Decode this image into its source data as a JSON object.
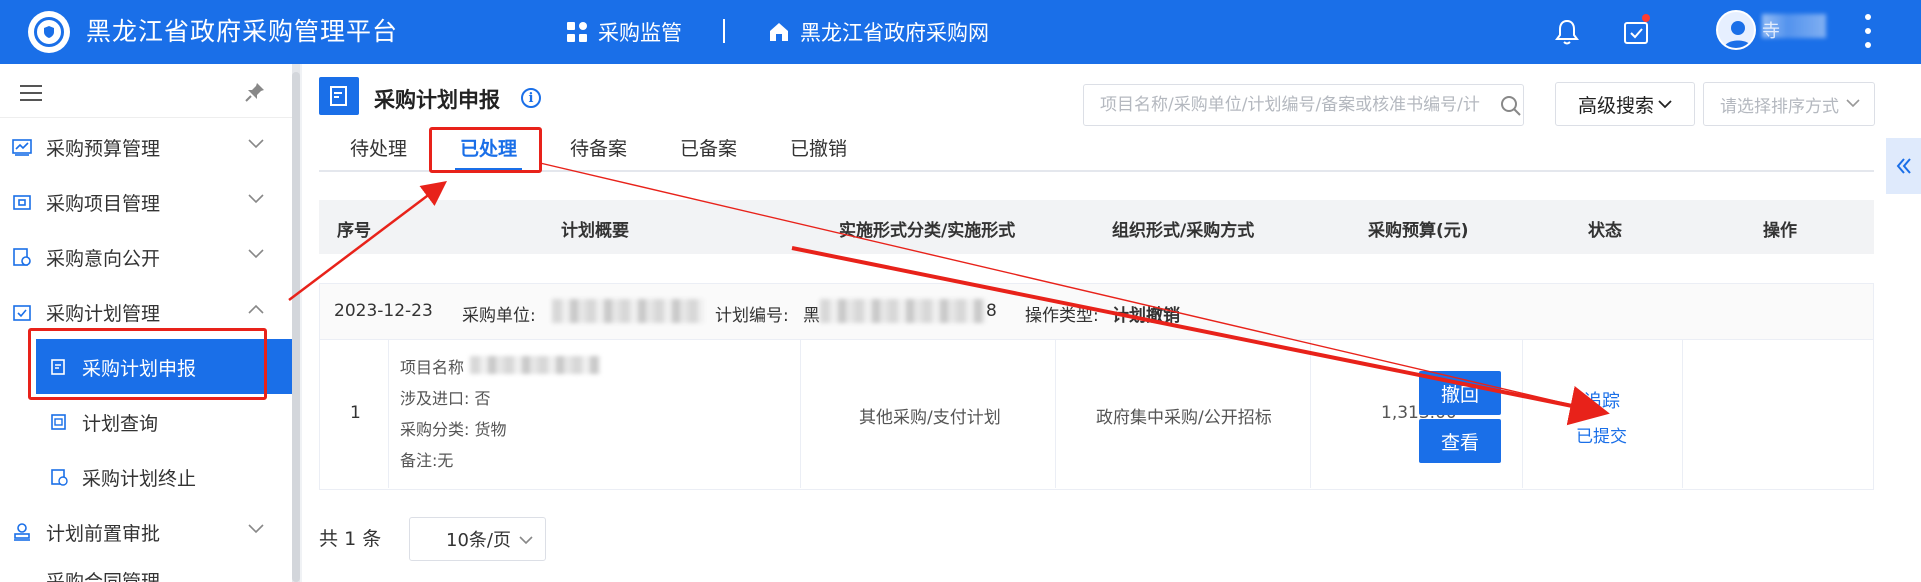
{
  "app": {
    "title": "黑龙江省政府采购管理平台"
  },
  "topnav": {
    "item1": "采购监管",
    "item2": "黑龙江省政府采购网"
  },
  "user": {
    "name_fragment": "寺"
  },
  "sidebar": {
    "items": [
      {
        "label": "采购预算管理"
      },
      {
        "label": "采购项目管理"
      },
      {
        "label": "采购意向公开"
      },
      {
        "label": "采购计划管理"
      },
      {
        "label": "计划前置审批"
      },
      {
        "label": "采购合同管理"
      }
    ],
    "sub_items": [
      {
        "label": "采购计划申报"
      },
      {
        "label": "计划查询"
      },
      {
        "label": "采购计划终止"
      }
    ]
  },
  "page": {
    "title": "采购计划申报"
  },
  "search": {
    "placeholder": "项目名称/采购单位/计划编号/备案或核准书编号/计"
  },
  "toolbar": {
    "advanced_label": "高级搜索",
    "sort_placeholder": "请选择排序方式"
  },
  "tabs": [
    {
      "label": "待处理"
    },
    {
      "label": "已处理"
    },
    {
      "label": "待备案"
    },
    {
      "label": "已备案"
    },
    {
      "label": "已撤销"
    }
  ],
  "table": {
    "headers": [
      "序号",
      "计划概要",
      "实施形式分类/实施形式",
      "组织形式/采购方式",
      "采购预算(元)",
      "状态",
      "操作"
    ]
  },
  "record": {
    "date": "2023-12-23",
    "unit_label": "采购单位:",
    "plan_no_label": "计划编号:",
    "plan_no_prefix": "黑",
    "plan_no_suffix": "8",
    "op_type_label": "操作类型:",
    "op_type_value": "计划撤销",
    "index": "1",
    "project_name_label": "项目名称",
    "import_label": "涉及进口:",
    "import_value": "否",
    "category_label": "采购分类:",
    "category_value": "货物",
    "remark_label": "备注:",
    "remark_value": "无",
    "impl_form": "其他采购/支付计划",
    "org_form": "政府集中采购/公开招标",
    "budget": "1,313.00",
    "track_link": "追踪",
    "status": "已提交",
    "withdraw_button": "撤回",
    "view_button": "查看"
  },
  "pagination": {
    "total_prefix": "共",
    "total_count": "1",
    "total_suffix": "条",
    "page_size": "10条/页"
  },
  "colors": {
    "primary": "#1a6fe8",
    "annotation": "#e8221a"
  }
}
